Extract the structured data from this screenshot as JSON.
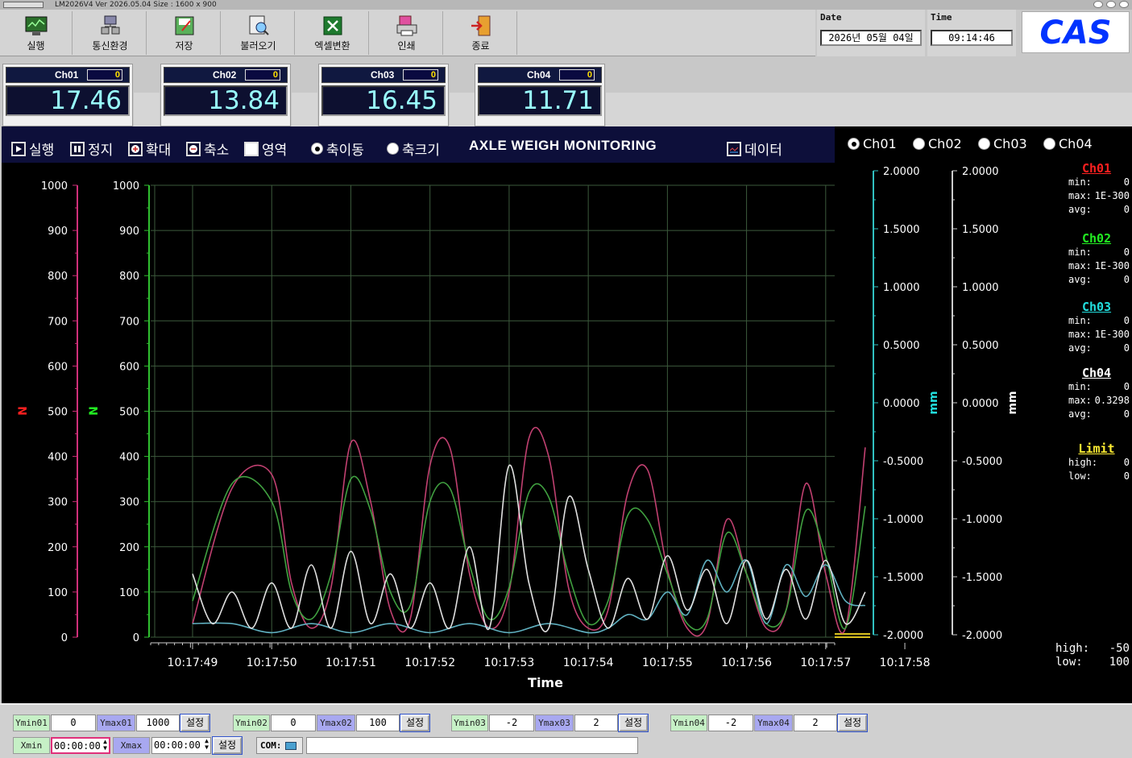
{
  "window": {
    "title": "LM2026V4  Ver 2026.05.04   Size : 1600 x 900"
  },
  "toolbar": [
    {
      "label": "실행",
      "icon": "monitor-icon"
    },
    {
      "label": "통신환경",
      "icon": "network-icon"
    },
    {
      "label": "저장",
      "icon": "save-icon"
    },
    {
      "label": "불러오기",
      "icon": "load-icon"
    },
    {
      "label": "엑셀변환",
      "icon": "excel-icon"
    },
    {
      "label": "인쇄",
      "icon": "print-icon"
    },
    {
      "label": "종료",
      "icon": "exit-icon"
    }
  ],
  "datetime": {
    "date_label": "Date",
    "date": "2026년  05월  04일",
    "time_label": "Time",
    "time": "09:14:46"
  },
  "brand": {
    "logo": "CAS",
    "color": "#0033ff"
  },
  "channels": [
    {
      "name": "Ch01",
      "offset": "0",
      "value": "17.46"
    },
    {
      "name": "Ch02",
      "offset": "0",
      "value": "13.84"
    },
    {
      "name": "Ch03",
      "offset": "0",
      "value": "16.45"
    },
    {
      "name": "Ch04",
      "offset": "0",
      "value": "11.71"
    }
  ],
  "controls": {
    "run": "실행",
    "stop": "정지",
    "zoom_in": "확대",
    "zoom_out": "축소",
    "area": "영역",
    "axis_move": "축이동",
    "axis_size": "축크기",
    "title": "AXLE WEIGH MONITORING",
    "data": "데이터"
  },
  "channel_select": {
    "options": [
      "Ch01",
      "Ch02",
      "Ch03",
      "Ch04"
    ],
    "selected": "Ch01"
  },
  "stats": [
    {
      "name": "Ch01",
      "color": "#ff2020",
      "min": "0",
      "max": "1E-300",
      "avg": "0"
    },
    {
      "name": "Ch02",
      "color": "#22ee22",
      "min": "0",
      "max": "1E-300",
      "avg": "0"
    },
    {
      "name": "Ch03",
      "color": "#22dddd",
      "min": "0",
      "max": "1E-300",
      "avg": "0"
    },
    {
      "name": "Ch04",
      "color": "#ffffff",
      "min": "0",
      "max": "0.3298",
      "avg": "0"
    }
  ],
  "limit": {
    "title": "Limit",
    "high_label": "high:",
    "high": "0",
    "low_label": "low:",
    "low": "0"
  },
  "limit2": {
    "high_label": "high:",
    "high": "-50",
    "low_label": "low:",
    "low": "100"
  },
  "chart_data": {
    "type": "line",
    "title": "AXLE WEIGH MONITORING",
    "xlabel": "Time",
    "x_ticks": [
      "10:17:49",
      "10:17:50",
      "10:17:51",
      "10:17:52",
      "10:17:53",
      "10:17:54",
      "10:17:55",
      "10:17:56",
      "10:17:57",
      "10:17:58"
    ],
    "y_left": {
      "label": "N",
      "ticks": [
        "1000",
        "900",
        "800",
        "700",
        "600",
        "500",
        "400",
        "300",
        "200",
        "100",
        "0"
      ],
      "ylim": [
        0,
        1000
      ]
    },
    "y_right": {
      "label": "mm",
      "ticks": [
        "2.0000",
        "1.5000",
        "1.0000",
        "0.5000",
        "0.0000",
        "-0.5000",
        "-1.0000",
        "-1.5000",
        "-2.0000"
      ],
      "ylim": [
        -2,
        2
      ]
    },
    "grid": true,
    "series": [
      {
        "name": "Ch01",
        "color": "#c04070",
        "x": [
          0,
          0.5,
          1,
          1.25,
          1.5,
          1.75,
          2,
          2.25,
          2.5,
          2.75,
          3,
          3.25,
          3.5,
          3.75,
          4,
          4.25,
          4.5,
          4.75,
          5,
          5.25,
          5.5,
          5.75,
          6,
          6.25,
          6.5,
          6.75,
          7,
          7.25,
          7.5,
          7.75,
          8,
          8.25,
          8.5
        ],
        "y": [
          30,
          330,
          360,
          120,
          20,
          110,
          430,
          300,
          60,
          40,
          380,
          420,
          140,
          20,
          100,
          440,
          400,
          110,
          20,
          60,
          320,
          370,
          150,
          20,
          30,
          260,
          140,
          20,
          60,
          340,
          140,
          20,
          420
        ]
      },
      {
        "name": "Ch02",
        "color": "#40a040",
        "x": [
          0,
          0.5,
          1,
          1.25,
          1.5,
          1.75,
          2,
          2.25,
          2.5,
          2.75,
          3,
          3.25,
          3.5,
          3.75,
          4,
          4.25,
          4.5,
          4.75,
          5,
          5.25,
          5.5,
          5.75,
          6,
          6.25,
          6.5,
          6.75,
          7,
          7.25,
          7.5,
          7.75,
          8,
          8.25,
          8.5
        ],
        "y": [
          80,
          340,
          300,
          100,
          40,
          140,
          350,
          280,
          100,
          70,
          300,
          330,
          160,
          40,
          110,
          320,
          310,
          140,
          30,
          80,
          270,
          260,
          140,
          30,
          40,
          230,
          140,
          30,
          60,
          280,
          180,
          20,
          290
        ]
      },
      {
        "name": "Ch03",
        "color": "#60b0c0",
        "x": [
          0,
          0.5,
          1,
          1.5,
          2,
          2.5,
          3,
          3.5,
          4,
          4.5,
          5,
          5.25,
          5.5,
          5.75,
          6,
          6.25,
          6.5,
          6.75,
          7,
          7.25,
          7.5,
          7.75,
          8,
          8.25,
          8.5
        ],
        "y": [
          30,
          30,
          10,
          30,
          10,
          30,
          10,
          30,
          10,
          30,
          10,
          20,
          50,
          40,
          100,
          50,
          170,
          100,
          170,
          30,
          160,
          90,
          160,
          80,
          70
        ]
      },
      {
        "name": "Ch04",
        "color": "#e0e0e0",
        "x": [
          0,
          0.25,
          0.5,
          0.75,
          1,
          1.25,
          1.5,
          1.75,
          2,
          2.25,
          2.5,
          2.75,
          3,
          3.25,
          3.5,
          3.75,
          4,
          4.25,
          4.5,
          4.75,
          5,
          5.25,
          5.5,
          5.75,
          6,
          6.25,
          6.5,
          6.75,
          7,
          7.25,
          7.5,
          7.75,
          8,
          8.25,
          8.5
        ],
        "y": [
          140,
          30,
          100,
          20,
          120,
          20,
          160,
          20,
          190,
          30,
          140,
          20,
          120,
          20,
          200,
          20,
          380,
          120,
          20,
          310,
          150,
          20,
          130,
          40,
          180,
          60,
          150,
          30,
          170,
          40,
          150,
          40,
          170,
          30,
          100
        ]
      }
    ]
  },
  "bottom": {
    "ymin01_label": "Ymin01",
    "ymin01": "0",
    "ymax01_label": "Ymax01",
    "ymax01": "1000",
    "ymin02_label": "Ymin02",
    "ymin02": "0",
    "ymax02_label": "Ymax02",
    "ymax02": "100",
    "ymin03_label": "Ymin03",
    "ymin03": "-2",
    "ymax03_label": "Ymax03",
    "ymax03": "2",
    "ymin04_label": "Ymin04",
    "ymin04": "-2",
    "ymax04_label": "Ymax04",
    "ymax04": "2",
    "set_label": "설정",
    "xmin_label": "Xmin",
    "xmin": "00:00:00",
    "xmax_label": "Xmax",
    "xmax": "00:00:00",
    "com_label": "COM:",
    "status": ""
  }
}
